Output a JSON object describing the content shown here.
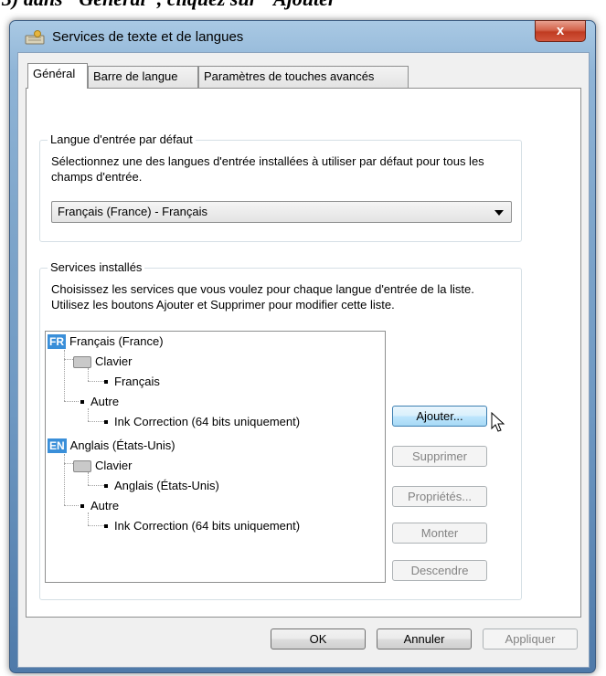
{
  "caption": "3) dans \"Général\", cliquez sur \"Ajouter\"",
  "window": {
    "title": "Services de texte et de langues",
    "close_label": "x"
  },
  "tabs": [
    {
      "label": "Général",
      "active": true
    },
    {
      "label": "Barre de langue",
      "active": false
    },
    {
      "label": "Paramètres de touches avancés",
      "active": false
    }
  ],
  "default_language": {
    "legend": "Langue d'entrée par défaut",
    "description": "Sélectionnez une des langues d'entrée installées à utiliser par défaut pour tous les champs d'entrée.",
    "selected": "Français (France) - Français"
  },
  "installed_services": {
    "legend": "Services installés",
    "description": "Choisissez les services que vous voulez pour chaque langue d'entrée de la liste. Utilisez les boutons Ajouter et Supprimer pour modifier cette liste.",
    "tree": [
      {
        "badge": "FR",
        "label": "Français (France)"
      },
      {
        "label": "Clavier"
      },
      {
        "label": "Français"
      },
      {
        "label": "Autre"
      },
      {
        "label": "Ink Correction (64 bits uniquement)"
      },
      {
        "badge": "EN",
        "label": "Anglais (États-Unis)"
      },
      {
        "label": "Clavier"
      },
      {
        "label": "Anglais (États-Unis)"
      },
      {
        "label": "Autre"
      },
      {
        "label": "Ink Correction (64 bits uniquement)"
      }
    ],
    "buttons": {
      "add": "Ajouter...",
      "remove": "Supprimer",
      "properties": "Propriétés...",
      "up": "Monter",
      "down": "Descendre"
    }
  },
  "footer": {
    "ok": "OK",
    "cancel": "Annuler",
    "apply": "Appliquer"
  },
  "colors": {
    "lang_badge": "#3a8fd9",
    "close_button": "#c03b21"
  }
}
